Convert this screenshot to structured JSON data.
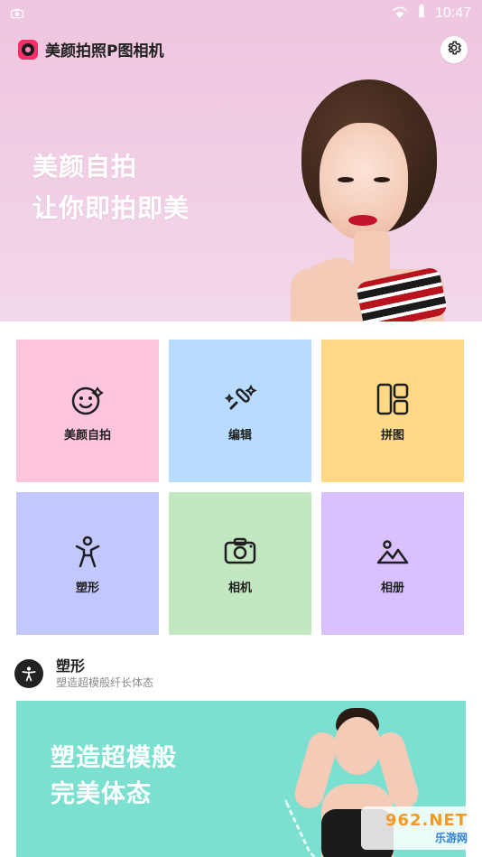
{
  "status_bar": {
    "time": "10:47",
    "icons": [
      "camera-icon",
      "wifi-icon",
      "battery-icon"
    ]
  },
  "header": {
    "app_title": "美颜拍照P图相机",
    "settings_icon": "gear-icon",
    "banner_lines": [
      "美颜自拍",
      "让你即拍即美"
    ]
  },
  "grid": [
    {
      "label": "美颜自拍",
      "icon": "smiley-sparkle-icon",
      "color": "#ffc5de"
    },
    {
      "label": "编辑",
      "icon": "magic-brush-icon",
      "color": "#b8dcff"
    },
    {
      "label": "拼图",
      "icon": "layout-grid-icon",
      "color": "#ffd985"
    },
    {
      "label": "塑形",
      "icon": "body-figure-icon",
      "color": "#c2c7ff"
    },
    {
      "label": "相机",
      "icon": "camera-icon",
      "color": "#c3e7c0"
    },
    {
      "label": "相册",
      "icon": "gallery-icon",
      "color": "#d9c1ff"
    }
  ],
  "section": {
    "icon": "accessibility-icon",
    "title": "塑形",
    "subtitle": "塑造超模般纤长体态"
  },
  "promo": {
    "lines": [
      "塑造超模般",
      "完美体态"
    ],
    "background": "#7be0d0"
  },
  "watermark": {
    "top": "962.NET",
    "bottom": "乐游网"
  },
  "colors": {
    "header_bg": "#efc7e0",
    "accent": "#ff2d6a"
  }
}
